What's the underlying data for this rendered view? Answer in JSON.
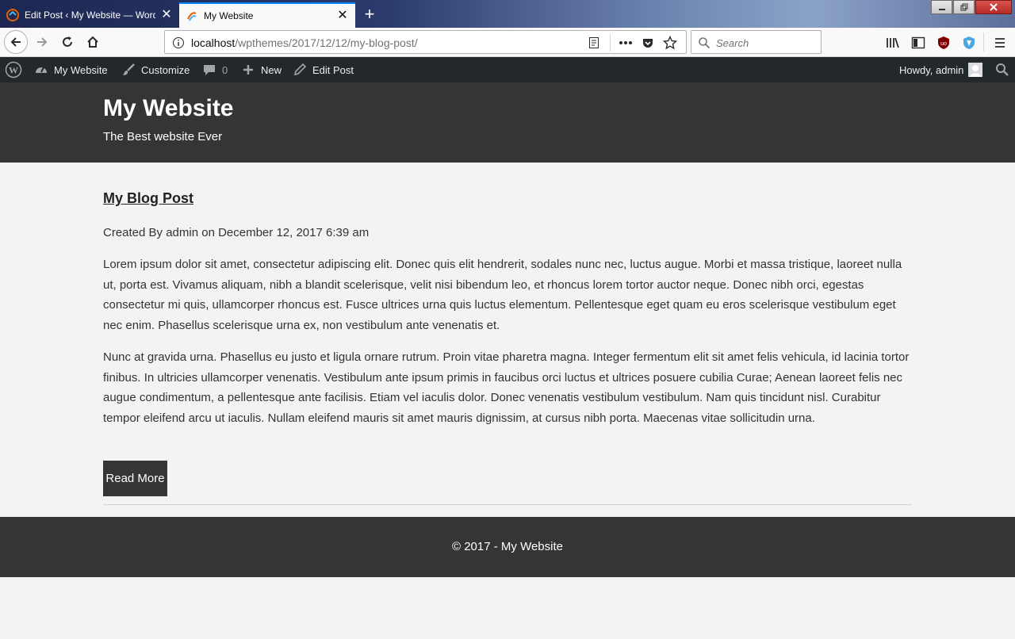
{
  "browser": {
    "tabs": [
      {
        "title": "Edit Post ‹ My Website — WordPress",
        "active": false
      },
      {
        "title": "My Website",
        "active": true
      }
    ],
    "address": {
      "host": "localhost",
      "path": "/wpthemes/2017/12/12/my-blog-post/"
    },
    "search_placeholder": "Search",
    "accent_color": "#0a84ff"
  },
  "adminbar": {
    "site_name": "My Website",
    "customize": "Customize",
    "comments_count": "0",
    "new": "New",
    "edit_post": "Edit Post",
    "greeting": "Howdy, admin"
  },
  "site": {
    "title": "My Website",
    "tagline": "The Best website Ever",
    "header_color": "#353535"
  },
  "post": {
    "title": "My Blog Post",
    "meta": "Created By admin on December 12, 2017 6:39 am",
    "paragraphs": [
      "Lorem ipsum dolor sit amet, consectetur adipiscing elit. Donec quis elit hendrerit, sodales nunc nec, luctus augue. Morbi et massa tristique, laoreet nulla ut, porta est. Vivamus aliquam, nibh a blandit scelerisque, velit nisi bibendum leo, et rhoncus lorem tortor auctor neque. Donec nibh orci, egestas consectetur mi quis, ullamcorper rhoncus est. Fusce ultrices urna quis luctus elementum. Pellentesque eget quam eu eros scelerisque vestibulum eget nec enim. Phasellus scelerisque urna ex, non vestibulum ante venenatis et.",
      "Nunc at gravida urna. Phasellus eu justo et ligula ornare rutrum. Proin vitae pharetra magna. Integer fermentum elit sit amet felis vehicula, id lacinia tortor finibus. In ultricies ullamcorper venenatis. Vestibulum ante ipsum primis in faucibus orci luctus et ultrices posuere cubilia Curae; Aenean laoreet felis nec augue condimentum, a pellentesque ante facilisis. Etiam vel iaculis dolor. Donec venenatis vestibulum vestibulum. Nam quis tincidunt nisl. Curabitur tempor eleifend arcu ut iaculis. Nullam eleifend mauris sit amet mauris dignissim, at cursus nibh porta. Maecenas vitae sollicitudin urna."
    ],
    "read_more": "Read More"
  },
  "footer": {
    "text": "© 2017 - My Website"
  }
}
